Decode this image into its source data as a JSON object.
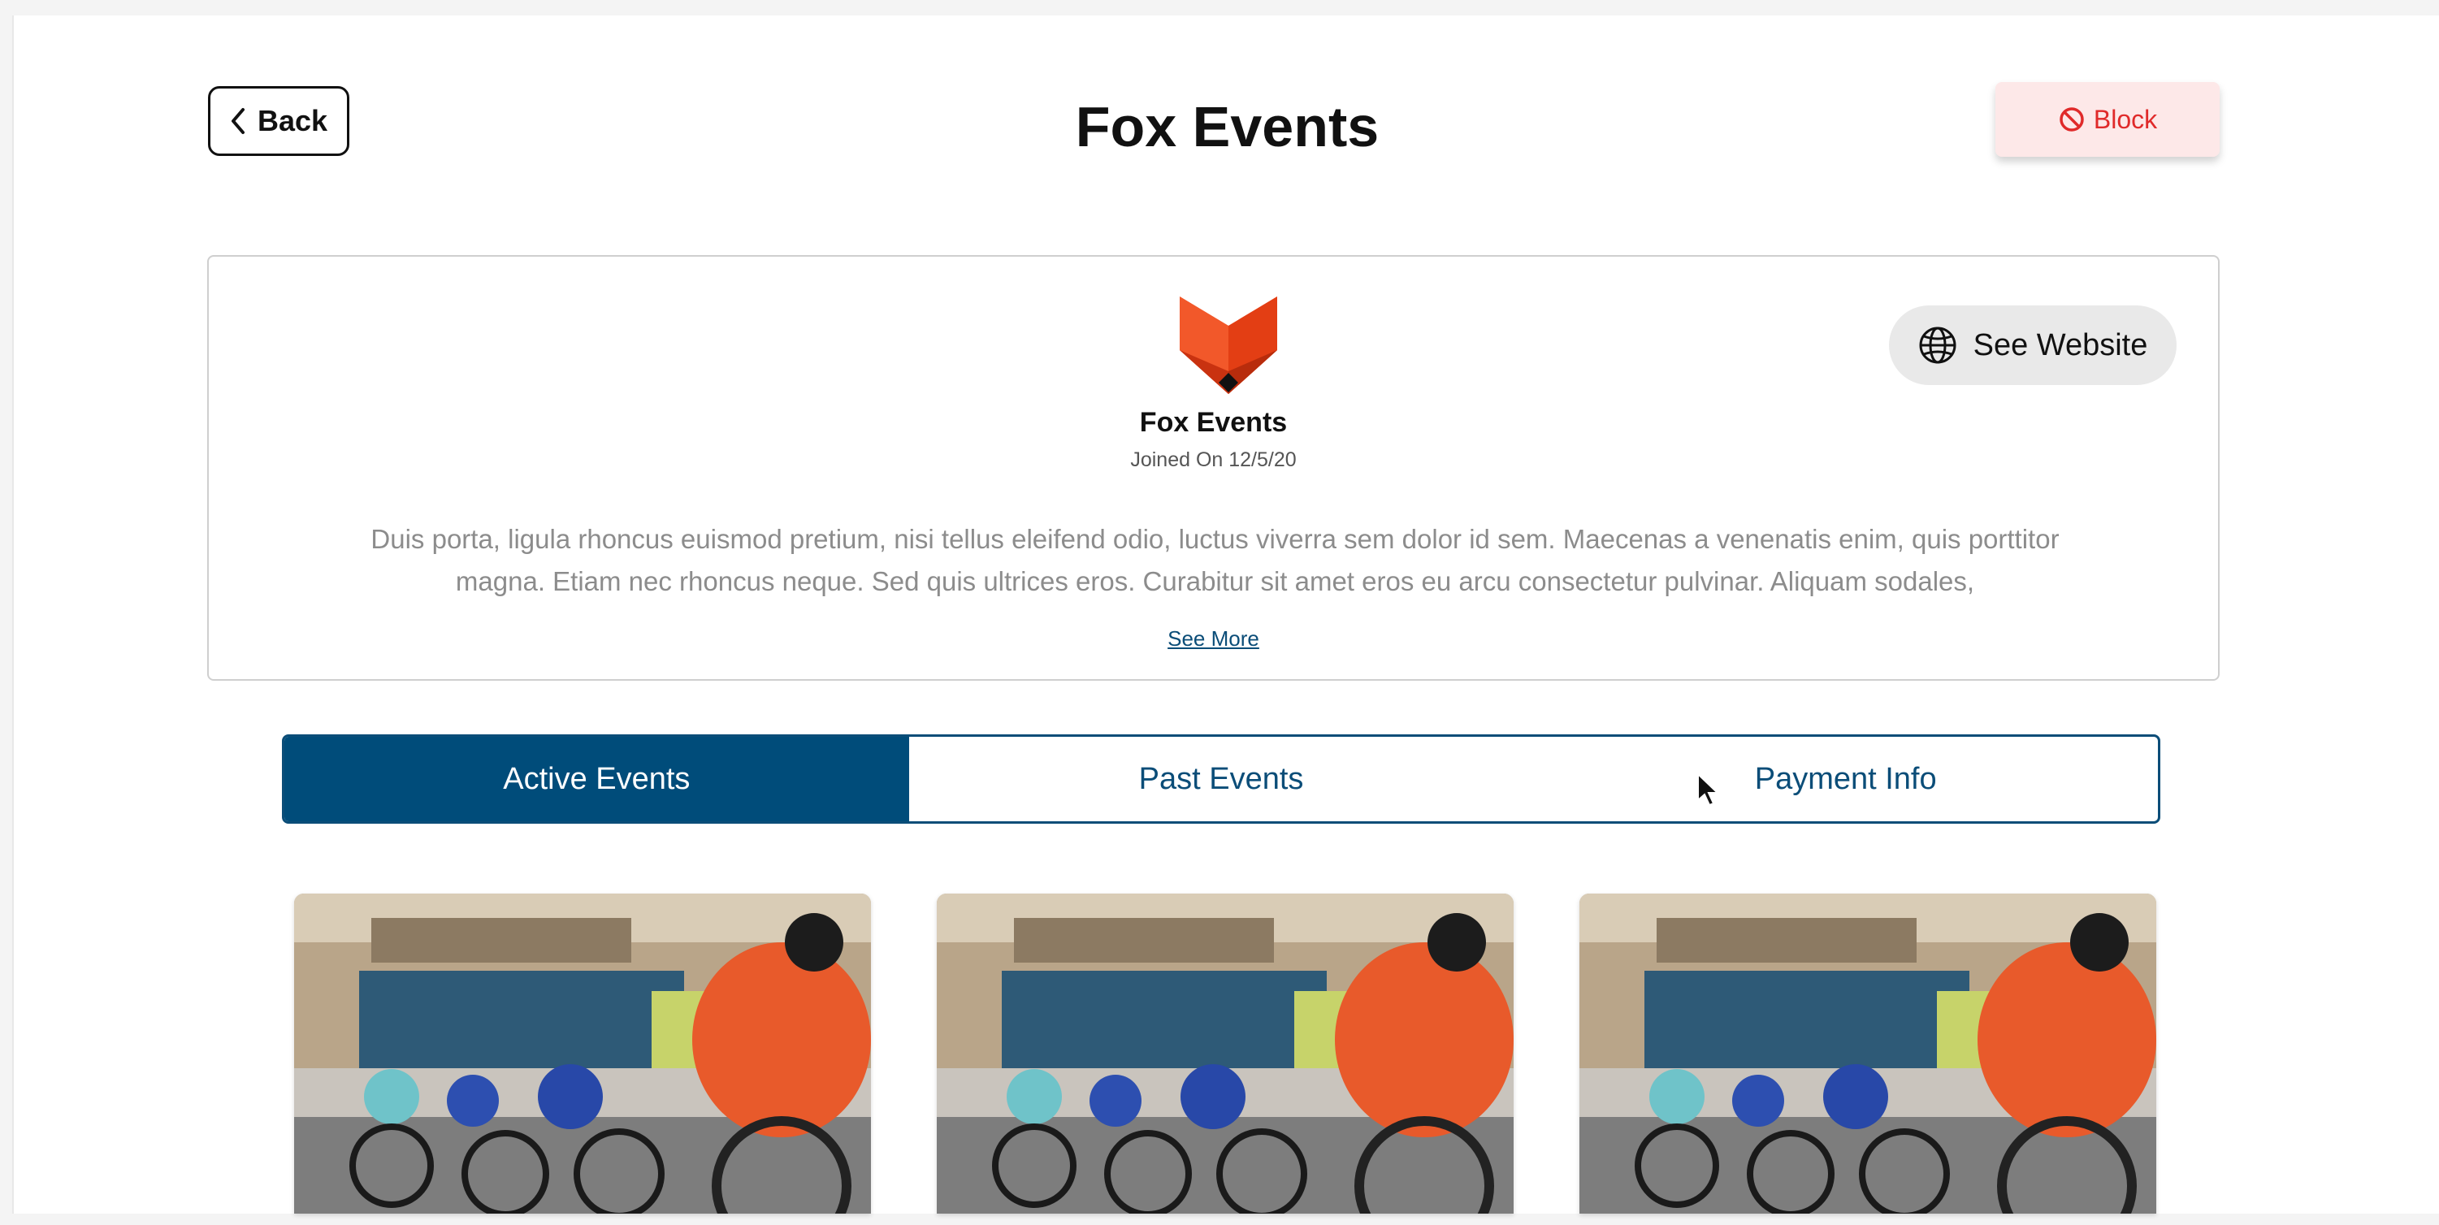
{
  "header": {
    "back_label": "Back",
    "title": "Fox Events",
    "block_label": "Block"
  },
  "profile": {
    "name": "Fox Events",
    "joined": "Joined On 12/5/20",
    "description": "Duis porta, ligula rhoncus euismod pretium, nisi tellus eleifend odio, luctus viverra sem dolor id sem. Maecenas a venenatis enim, quis porttitor magna. Etiam nec rhoncus neque. Sed quis ultrices eros. Curabitur sit amet eros eu arcu consectetur pulvinar. Aliquam sodales,",
    "see_more": "See More",
    "website_label": "See Website"
  },
  "tabs": [
    {
      "label": "Active Events",
      "active": true
    },
    {
      "label": "Past Events",
      "active": false
    },
    {
      "label": "Payment Info",
      "active": false
    }
  ],
  "events": [
    {
      "image": "cyclists-race-photo"
    },
    {
      "image": "cyclists-race-photo"
    },
    {
      "image": "cyclists-race-photo"
    }
  ],
  "colors": {
    "primary": "#004c7a",
    "block_bg": "#fde8e8",
    "block_text": "#e02a2a",
    "logo_orange": "#f04a1c"
  }
}
